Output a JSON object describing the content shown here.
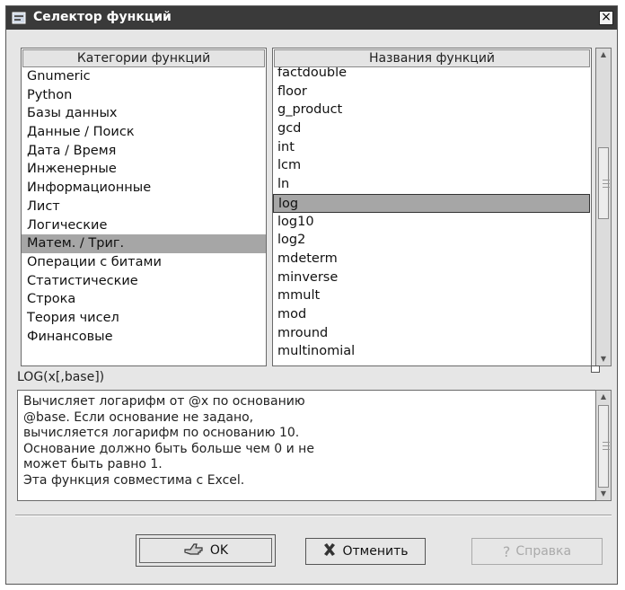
{
  "window": {
    "title": "Селектор функций"
  },
  "categories": {
    "header": "Категории функций",
    "items": [
      "Gnumeric",
      "Python",
      "Базы данных",
      "Данные / Поиск",
      "Дата / Время",
      "Инженерные",
      "Информационные",
      "Лист",
      "Логические",
      "Матем. / Триг.",
      "Операции с битами",
      "Статистические",
      "Строка",
      "Теория чисел",
      "Финансовые"
    ],
    "selected": "Матем. / Триг."
  },
  "functions": {
    "header": "Названия функций",
    "items": [
      "factdouble",
      "floor",
      "g_product",
      "gcd",
      "int",
      "lcm",
      "ln",
      "log",
      "log10",
      "log2",
      "mdeterm",
      "minverse",
      "mmult",
      "mod",
      "mround",
      "multinomial"
    ],
    "selected": "log"
  },
  "description": {
    "signature": "LOG(x[,base])",
    "text": "Вычисляет логарифм от @x по основанию\n@base. Если основание не задано,\nвычисляется логарифм по основанию 10.\nОснование должно быть больше чем 0 и не\nможет быть равно 1.\nЭта функция совместима с Excel."
  },
  "buttons": {
    "ok": "OK",
    "cancel": "Отменить",
    "help": "Справка"
  },
  "icons": {
    "window": "window-app-icon",
    "close": "close-icon",
    "ok": "ok-hand-icon",
    "cancel": "cross-icon",
    "help": "question-icon"
  }
}
